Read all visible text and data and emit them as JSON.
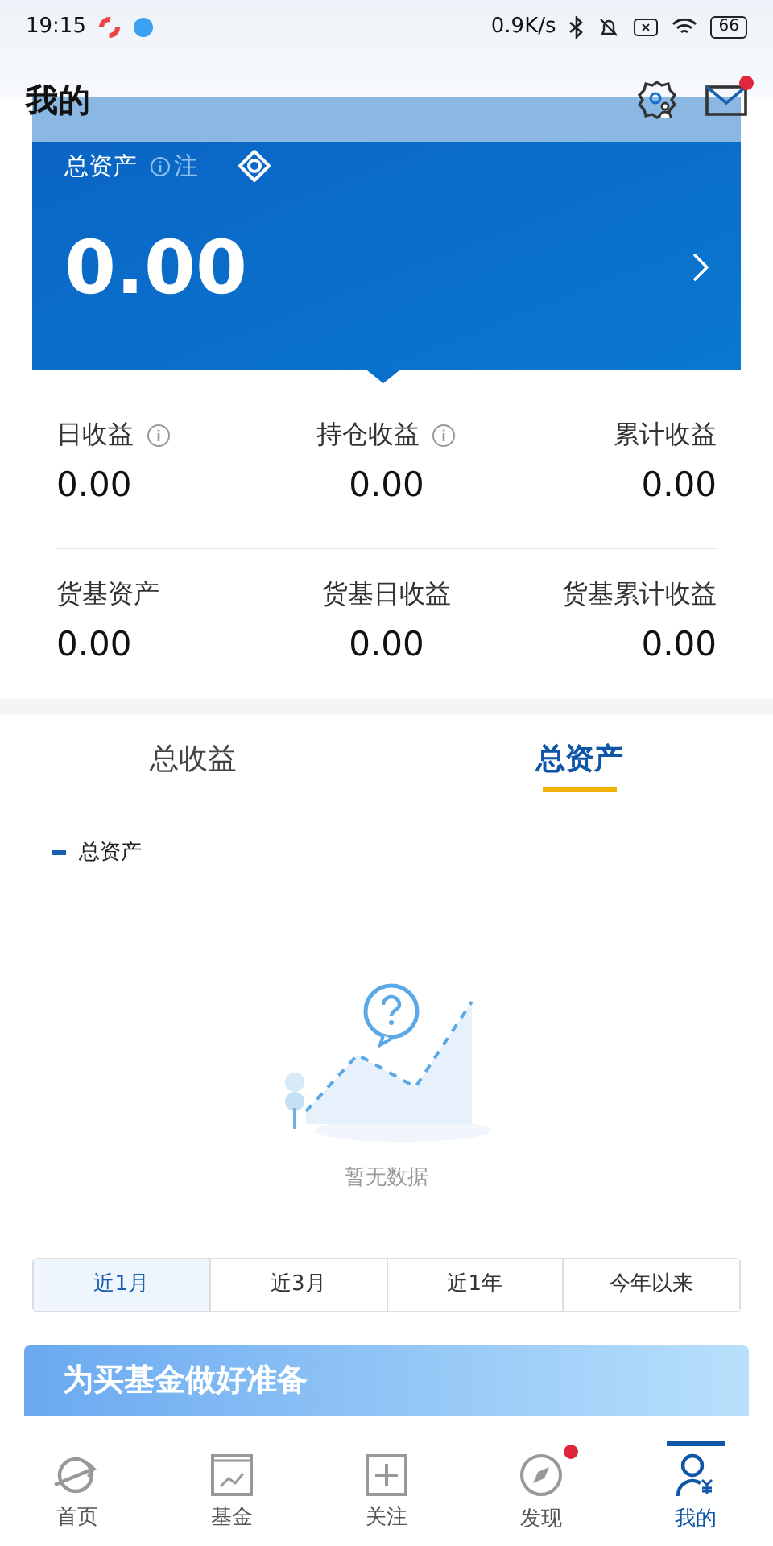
{
  "status_bar": {
    "time": "19:15",
    "speed": "0.9K/s",
    "battery": "66"
  },
  "header": {
    "title": "我的",
    "mail_unread": true
  },
  "asset_card": {
    "label": "总资产",
    "note": "注",
    "value": "0.00"
  },
  "stats": [
    {
      "label": "日收益",
      "info": true,
      "value": "0.00"
    },
    {
      "label": "持仓收益",
      "info": true,
      "value": "0.00"
    },
    {
      "label": "累计收益",
      "info": false,
      "value": "0.00"
    },
    {
      "label": "货基资产",
      "info": false,
      "value": "0.00"
    },
    {
      "label": "货基日收益",
      "info": false,
      "value": "0.00"
    },
    {
      "label": "货基累计收益",
      "info": false,
      "value": "0.00"
    }
  ],
  "tabs": [
    {
      "label": "总收益",
      "selected": false
    },
    {
      "label": "总资产",
      "selected": true
    }
  ],
  "chart": {
    "legend": "总资产",
    "empty_text": "暂无数据"
  },
  "ranges": [
    {
      "label": "近1月",
      "selected": true
    },
    {
      "label": "近3月",
      "selected": false
    },
    {
      "label": "近1年",
      "selected": false
    },
    {
      "label": "今年以来",
      "selected": false
    }
  ],
  "banner": {
    "title": "为买基金做好准备"
  },
  "nav": [
    {
      "label": "首页",
      "kind": "home",
      "selected": false,
      "badge": false
    },
    {
      "label": "基金",
      "kind": "fund",
      "selected": false,
      "badge": false
    },
    {
      "label": "关注",
      "kind": "watch",
      "selected": false,
      "badge": false
    },
    {
      "label": "发现",
      "kind": "discover",
      "selected": false,
      "badge": true
    },
    {
      "label": "我的",
      "kind": "mine",
      "selected": true,
      "badge": false
    }
  ]
}
